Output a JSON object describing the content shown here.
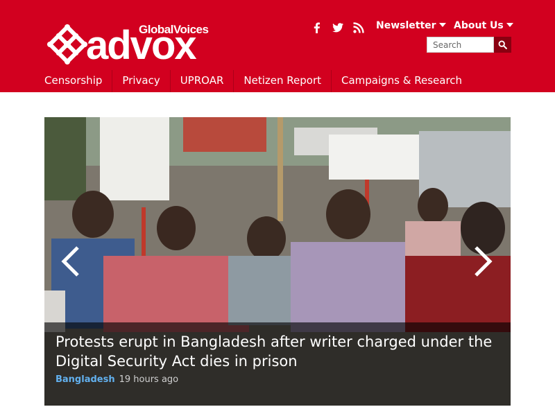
{
  "brand": {
    "top_line_a": "Global",
    "top_line_b": "Voices",
    "wordmark": "advox",
    "color": "#d2001f"
  },
  "social": {
    "icons": [
      "facebook-icon",
      "twitter-icon",
      "rss-icon"
    ]
  },
  "top_links": {
    "newsletter": "Newsletter",
    "about": "About Us"
  },
  "search": {
    "placeholder": "Search",
    "icon": "search-icon"
  },
  "nav": {
    "items": [
      "Censorship",
      "Privacy",
      "UPROAR",
      "Netizen Report",
      "Campaigns & Research"
    ]
  },
  "hero": {
    "title": "Protests erupt in Bangladesh after writer charged under the Digital Security Act dies in prison",
    "category": "Bangladesh",
    "time": "19 hours ago",
    "category_color": "#62b0ee",
    "prev_icon": "chevron-left-icon",
    "next_icon": "chevron-right-icon"
  }
}
